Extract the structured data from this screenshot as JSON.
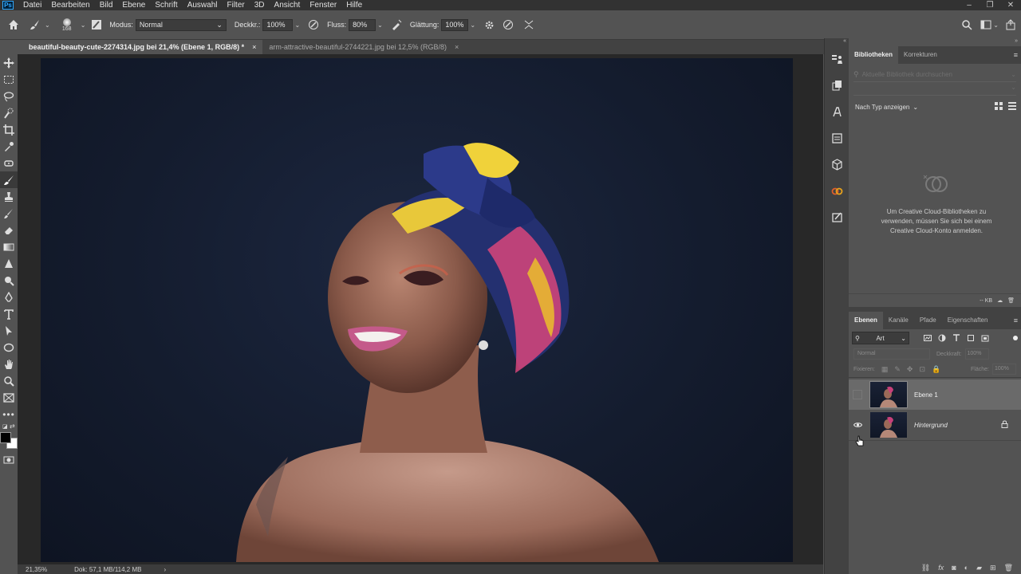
{
  "app": {
    "logo": "Ps"
  },
  "menubar": {
    "items": [
      "Datei",
      "Bearbeiten",
      "Bild",
      "Ebene",
      "Schrift",
      "Auswahl",
      "Filter",
      "3D",
      "Ansicht",
      "Fenster",
      "Hilfe"
    ]
  },
  "window_controls": [
    "–",
    "❐",
    "✕"
  ],
  "options": {
    "brush_size": "168",
    "mode_label": "Modus:",
    "mode_value": "Normal",
    "opacity_label": "Deckkr.:",
    "opacity_value": "100%",
    "flow_label": "Fluss:",
    "flow_value": "80%",
    "smoothing_label": "Glättung:",
    "smoothing_value": "100%"
  },
  "tabs": [
    {
      "label": "beautiful-beauty-cute-2274314.jpg bei 21,4% (Ebene 1, RGB/8) *",
      "close": "×"
    },
    {
      "label": "arm-attractive-beautiful-2744221.jpg bei 12,5% (RGB/8)",
      "close": "×"
    }
  ],
  "status": {
    "zoom": "21,35%",
    "doc": "Dok: 57,1 MB/114,2 MB",
    "arrow": "›"
  },
  "libraries": {
    "tabs": [
      "Bibliotheken",
      "Korrekturen"
    ],
    "search_placeholder": "Aktuelle Bibliothek durchsuchen",
    "view_by": "Nach Typ anzeigen",
    "message": "Um Creative Cloud-Bibliotheken zu verwenden, müssen Sie sich bei einem Creative Cloud-Konto anmelden.",
    "footer_size": "-- KB"
  },
  "layers": {
    "tabs": [
      "Ebenen",
      "Kanäle",
      "Pfade",
      "Eigenschaften"
    ],
    "filter_kind": "Art",
    "blend_mode": "Normal",
    "opacity_label": "Deckkraft:",
    "opacity_value": "100%",
    "lock_label": "Fixieren:",
    "fill_label": "Fläche:",
    "fill_value": "100%",
    "items": [
      {
        "name": "Ebene 1",
        "selected": true,
        "visible": false
      },
      {
        "name": "Hintergrund",
        "selected": false,
        "visible": true,
        "locked": true
      }
    ],
    "footer_icons": [
      "link-icon",
      "fx-icon",
      "mask-icon",
      "adjustment-icon",
      "group-icon",
      "new-layer-icon",
      "trash-icon"
    ]
  },
  "colors": {
    "foreground": "#000000",
    "background": "#ffffff",
    "accent": "#31a8ff"
  }
}
